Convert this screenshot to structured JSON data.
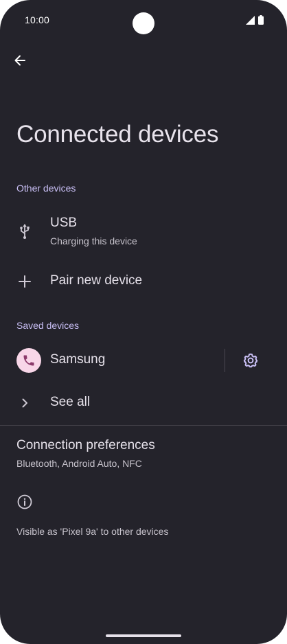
{
  "status_bar": {
    "time": "10:00"
  },
  "page": {
    "title": "Connected devices"
  },
  "sections": {
    "other_devices": "Other devices",
    "saved_devices": "Saved devices"
  },
  "usb": {
    "title": "USB",
    "subtitle": "Charging this device"
  },
  "pair": {
    "title": "Pair new device"
  },
  "samsung": {
    "title": "Samsung"
  },
  "see_all": {
    "title": "See all"
  },
  "connection_prefs": {
    "title": "Connection preferences",
    "subtitle": "Bluetooth, Android Auto, NFC"
  },
  "footer": {
    "visible_as": "Visible as 'Pixel 9a' to other devices"
  },
  "colors": {
    "background": "#24232b",
    "accent": "#c9bff5",
    "avatar_bg": "#f8d6e8",
    "avatar_icon": "#8c3a6b"
  }
}
